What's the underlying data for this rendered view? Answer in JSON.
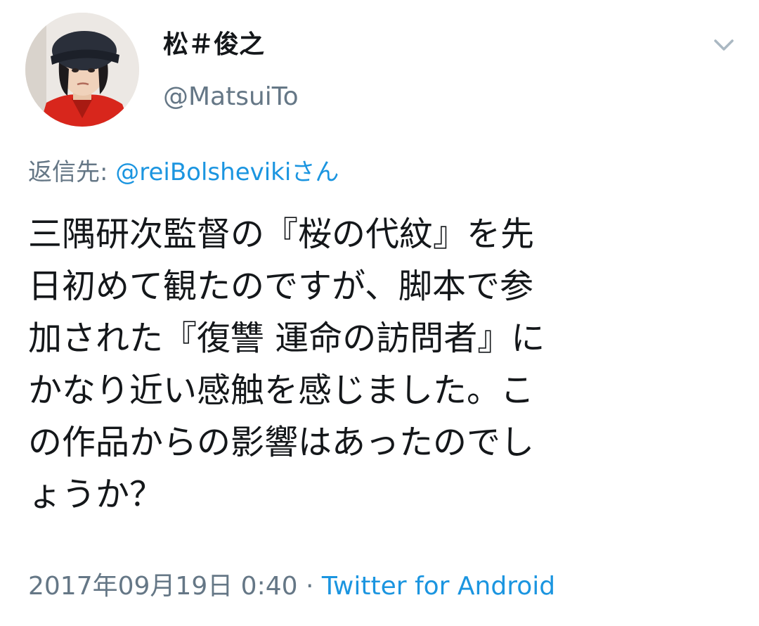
{
  "author": {
    "display_name": "松＃俊之",
    "handle": "@MatsuiTo",
    "avatar_icon": "profile-photo"
  },
  "menu": {
    "icon": "chevron-down-icon"
  },
  "reply_to": {
    "prefix": "返信先: ",
    "mention": "@reiBolshevikiさん"
  },
  "tweet": {
    "text": "三隅研次監督の『桜の代紋』を先\n日初めて観たのですが、脚本で参\n加された『復讐 運命の訪問者』に\nかなり近い感触を感じました。こ\nの作品からの影響はあったのでし\nょうか？"
  },
  "meta": {
    "timestamp": "2017年09月19日 0:40",
    "separator": " · ",
    "source": "Twitter for Android"
  },
  "colors": {
    "text": "#14171a",
    "secondary": "#657786",
    "link": "#1b95e0",
    "background": "#ffffff"
  }
}
